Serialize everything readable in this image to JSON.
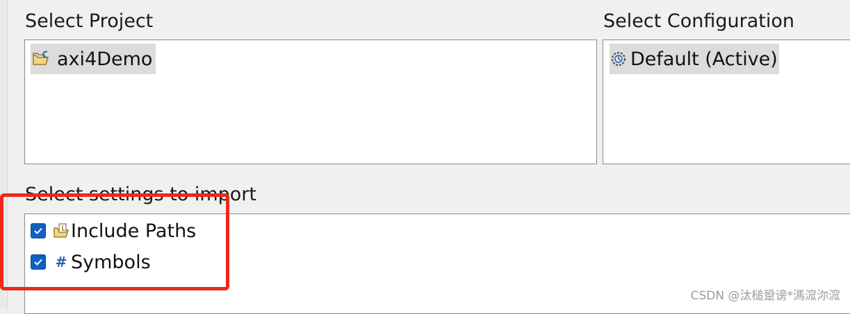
{
  "project_section": {
    "label": "Select Project",
    "items": [
      {
        "label": "axi4Demo",
        "icon": "c-project-folder-icon"
      }
    ]
  },
  "configuration_section": {
    "label": "Select Configuration",
    "items": [
      {
        "label": "Default (Active)",
        "icon": "configuration-gear-icon"
      }
    ]
  },
  "settings_section": {
    "label": "Select settings to import",
    "items": [
      {
        "label": "Include Paths",
        "checked": true,
        "icon": "include-paths-icon"
      },
      {
        "label": "Symbols",
        "checked": true,
        "icon": "hash-symbol-icon"
      }
    ]
  },
  "annotation": {
    "color": "#f0271c"
  },
  "watermark": {
    "text": "CSDN @汰槌跫谤*溤溛沵溛"
  },
  "colors": {
    "selection_bg": "#dcdcdc",
    "checkbox_blue": "#1060c0",
    "window_bg": "#f0f0f0"
  }
}
